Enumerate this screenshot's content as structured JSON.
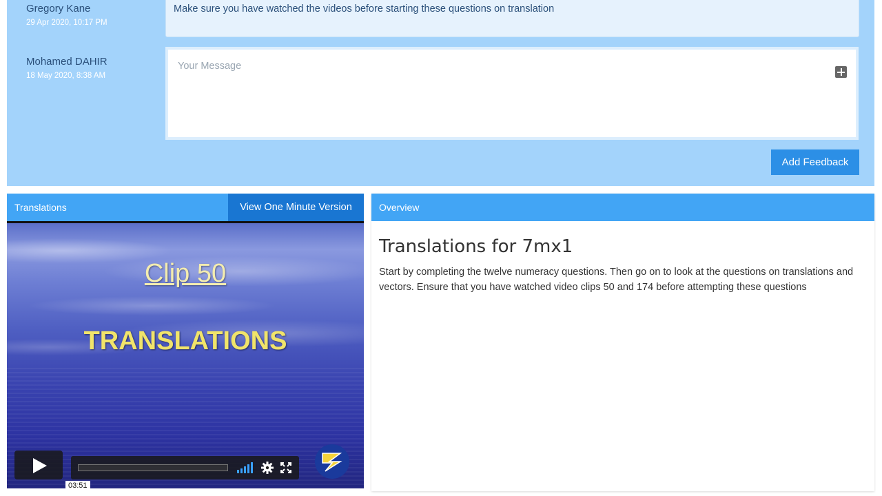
{
  "feedback": {
    "messages": [
      {
        "author": "Gregory Kane",
        "time": "29 Apr 2020, 10:17 PM",
        "text": "Make sure you have watched the videos before starting these questions on translation"
      }
    ],
    "current_user": {
      "author": "Mohamed DAHIR",
      "time": "18 May 2020, 8:38 AM"
    },
    "input_placeholder": "Your Message",
    "add_button_label": "Add Feedback"
  },
  "video": {
    "header_title": "Translations",
    "one_minute_button_label": "View One Minute Version",
    "clip_title": "Clip 50",
    "clip_subtitle": "TRANSLATIONS",
    "duration": "03:51",
    "playback_progress": 0,
    "icons": [
      "play-icon",
      "volume-icon",
      "settings-icon",
      "fullscreen-icon",
      "vimeo-logo"
    ]
  },
  "overview": {
    "header_title": "Overview",
    "title": "Translations for 7mx1",
    "description": "Start by completing the twelve numeracy questions. Then go on to look at the questions on translations and vectors. Ensure that you have watched video clips 50 and 174 before attempting these questions"
  },
  "colors": {
    "panel_blue": "#a3d3fb",
    "header_blue": "#42a5f5",
    "button_blue": "#2c8fe6",
    "dark_button_blue": "#1976d2"
  }
}
